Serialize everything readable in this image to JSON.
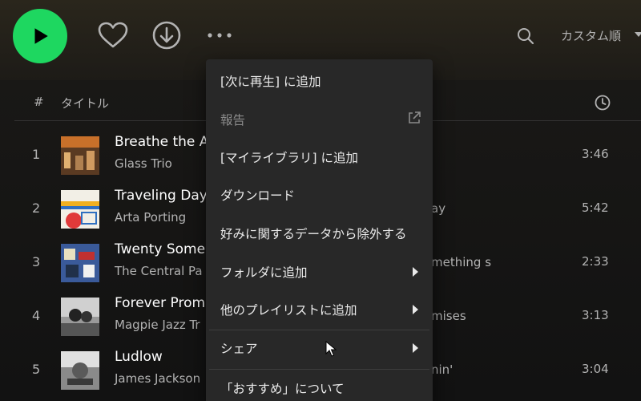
{
  "sort": {
    "label": "カスタム順"
  },
  "header": {
    "num": "#",
    "title": "タイトル"
  },
  "tracks": [
    {
      "num": "1",
      "title": "Breathe the A",
      "artist": "Glass Trio",
      "album": "",
      "duration": "3:46"
    },
    {
      "num": "2",
      "title": "Traveling Day",
      "artist": "Arta Porting",
      "album": "ay",
      "duration": "5:42"
    },
    {
      "num": "3",
      "title": "Twenty Some",
      "artist": "The Central Pa",
      "album": "mething s",
      "duration": "2:33"
    },
    {
      "num": "4",
      "title": "Forever Prom",
      "artist": "Magpie Jazz Tr",
      "album": "mises",
      "duration": "3:13"
    },
    {
      "num": "5",
      "title": "Ludlow",
      "artist": "James Jackson",
      "album": "nin'",
      "duration": "3:04"
    }
  ],
  "menu": {
    "items": [
      {
        "label": "[次に再生] に追加"
      },
      {
        "label": "報告"
      },
      {
        "label": "[マイライブラリ] に追加"
      },
      {
        "label": "ダウンロード"
      },
      {
        "label": "好みに関するデータから除外する"
      },
      {
        "label": "フォルダに追加"
      },
      {
        "label": "他のプレイリストに追加"
      },
      {
        "label": "シェア"
      },
      {
        "label": "「おすすめ」について"
      }
    ]
  },
  "colors": {
    "accent": "#1ed760",
    "menu_bg": "#282828"
  },
  "icons": [
    "play-icon",
    "heart-icon",
    "download-icon",
    "more-icon",
    "search-icon",
    "clock-icon",
    "external-link-icon",
    "chevron-right-icon"
  ]
}
